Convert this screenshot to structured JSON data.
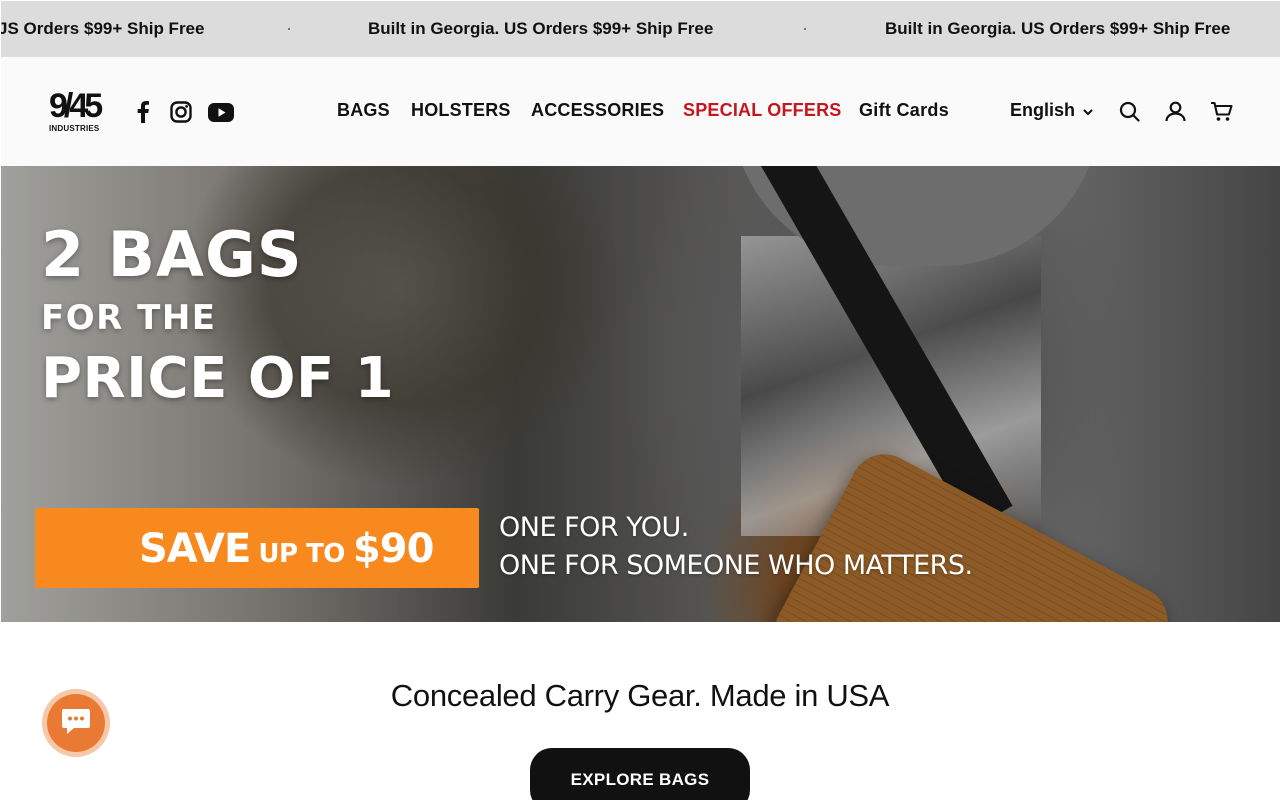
{
  "announcement": {
    "messages": [
      "JS Orders $99+ Ship Free",
      "Built in Georgia. US Orders $99+ Ship Free",
      "Built in Georgia. US Orders $99+ Ship Free"
    ]
  },
  "header": {
    "logo_number": "9/45",
    "logo_sub": "INDUSTRIES",
    "social": [
      "facebook-icon",
      "instagram-icon",
      "youtube-icon"
    ],
    "nav": [
      {
        "label": "BAGS"
      },
      {
        "label": "HOLSTERS"
      },
      {
        "label": "ACCESSORIES"
      },
      {
        "label": "SPECIAL OFFERS",
        "color": "#c4161c"
      },
      {
        "label": "Gift Cards"
      }
    ],
    "language": "English",
    "icons": [
      "search-icon",
      "account-icon",
      "cart-icon"
    ]
  },
  "hero": {
    "line1": "2 BAGS",
    "line2": "FOR THE",
    "line3": "PRICE OF 1",
    "save_big": "SAVE",
    "save_small": "UP TO",
    "save_amount": "$90",
    "tagline1": "ONE FOR YOU.",
    "tagline2": "ONE FOR SOMEONE WHO MATTERS.",
    "accent_color": "#f7891e"
  },
  "main": {
    "subtitle": "Concealed Carry Gear. Made in USA",
    "cta_label": "EXPLORE BAGS"
  },
  "chat": {
    "icon": "chat-icon",
    "color": "#ea7a33"
  }
}
